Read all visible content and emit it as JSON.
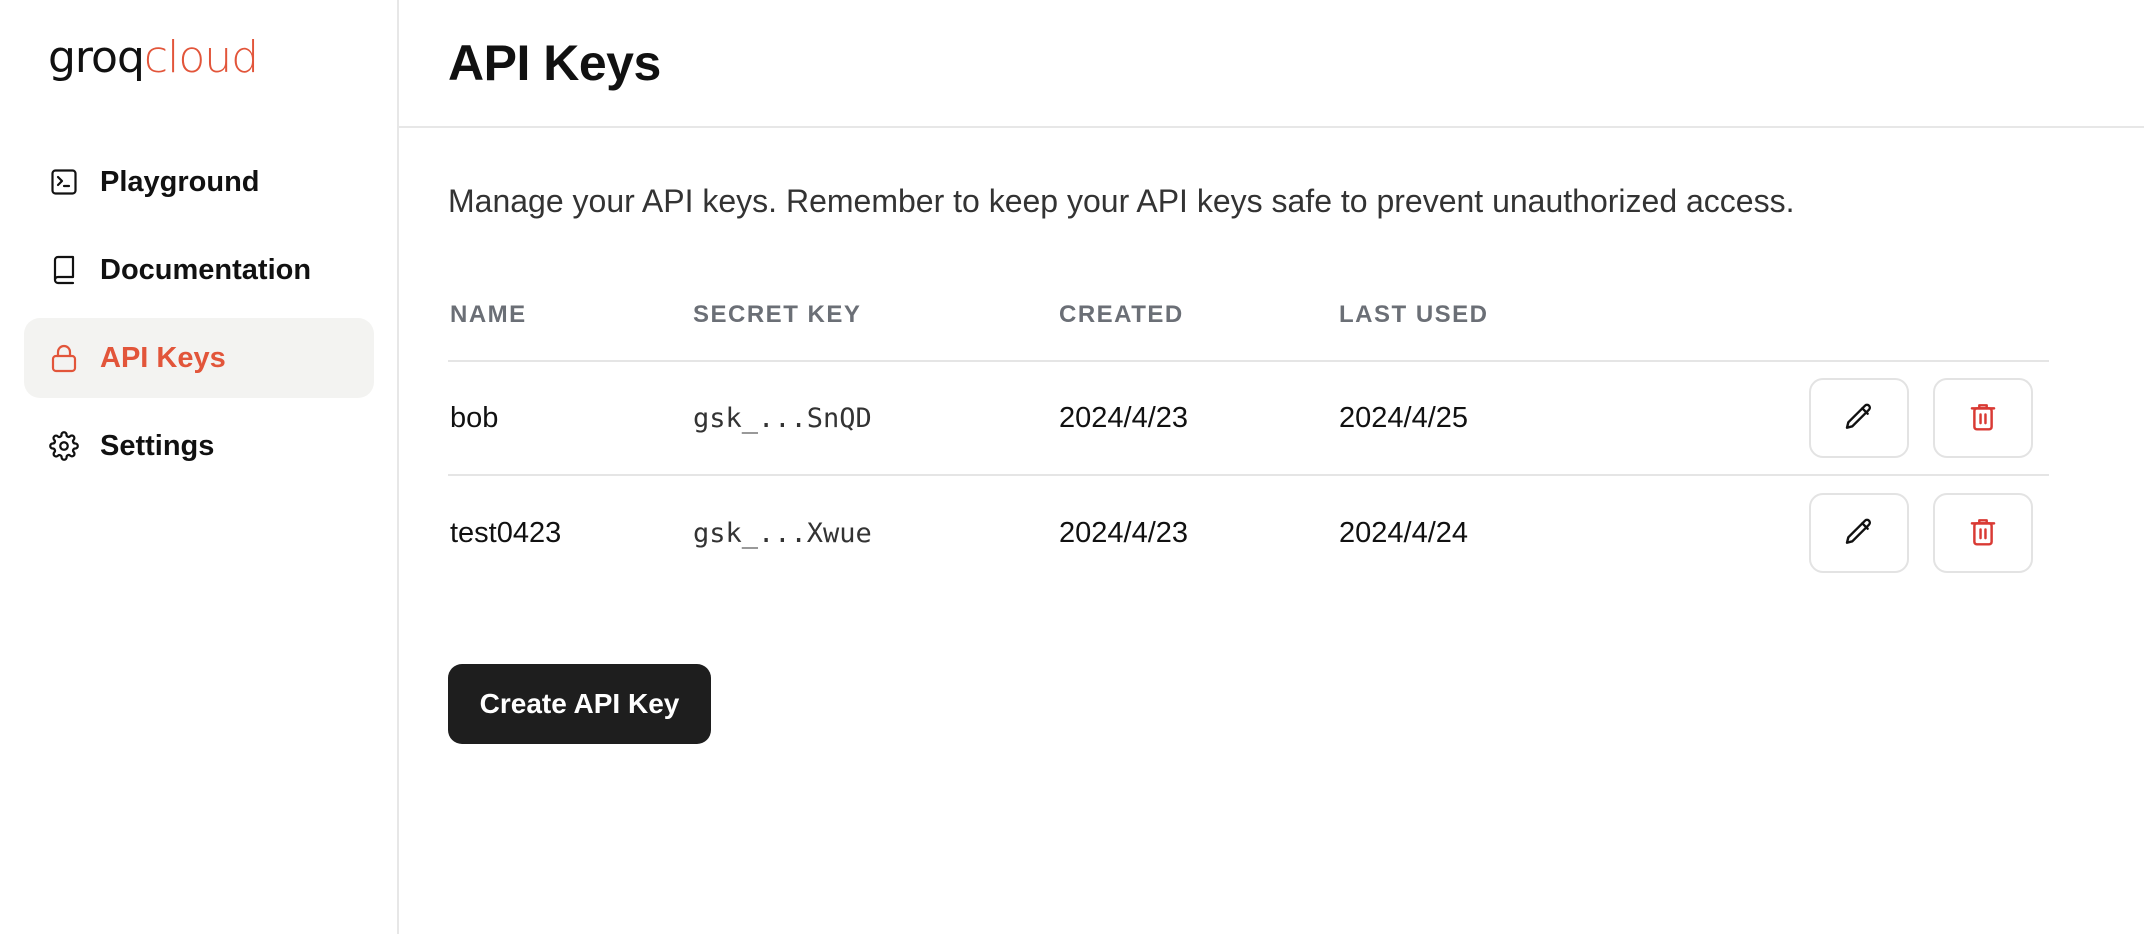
{
  "brand": {
    "logo_part1": "groq",
    "logo_part2": "cloud",
    "accent_color": "#e2553a"
  },
  "sidebar": {
    "items": [
      {
        "label": "Playground",
        "icon": "terminal-icon",
        "active": false
      },
      {
        "label": "Documentation",
        "icon": "book-icon",
        "active": false
      },
      {
        "label": "API Keys",
        "icon": "lock-icon",
        "active": true
      },
      {
        "label": "Settings",
        "icon": "gear-icon",
        "active": false
      }
    ]
  },
  "header": {
    "title": "API Keys"
  },
  "main": {
    "description": "Manage your API keys. Remember to keep your API keys safe to prevent unauthorized access.",
    "table": {
      "columns": [
        "NAME",
        "SECRET KEY",
        "CREATED",
        "LAST USED"
      ],
      "rows": [
        {
          "name": "bob",
          "secret_key": "gsk_...SnQD",
          "created": "2024/4/23",
          "last_used": "2024/4/25"
        },
        {
          "name": "test0423",
          "secret_key": "gsk_...Xwue",
          "created": "2024/4/23",
          "last_used": "2024/4/24"
        }
      ]
    },
    "create_button_label": "Create API Key"
  },
  "icons": {
    "edit": "pencil-icon",
    "delete": "trash-icon",
    "delete_color": "#d93a34"
  }
}
